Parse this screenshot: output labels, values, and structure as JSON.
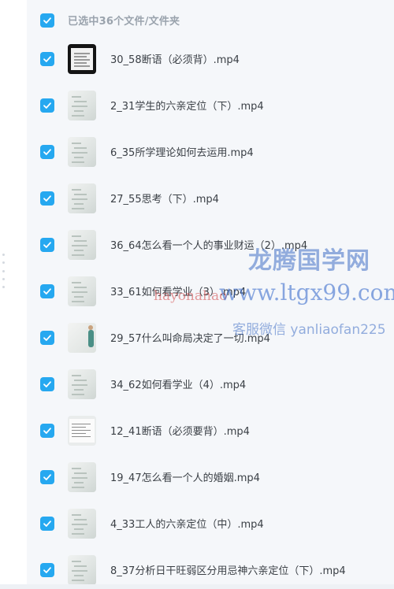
{
  "header": {
    "selection_text": "已选中36个文件/文件夹",
    "select_all_checked": true
  },
  "colors": {
    "accent": "#26a8f0",
    "text": "#3a3f45",
    "muted": "#9aa3ad"
  },
  "files": [
    {
      "name": "30_58断语（必须背）.mp4",
      "thumb": "dark"
    },
    {
      "name": "2_31学生的六亲定位（下）.mp4",
      "thumb": "board"
    },
    {
      "name": "6_35所学理论如何去运用.mp4",
      "thumb": "board"
    },
    {
      "name": "27_55思考（下）.mp4",
      "thumb": "board"
    },
    {
      "name": "36_64怎么看一个人的事业财运（2）.mp4",
      "thumb": "board"
    },
    {
      "name": "33_61如何看学业（3）.mp4",
      "thumb": "board"
    },
    {
      "name": "29_57什么叫命局决定了一切.mp4",
      "thumb": "person"
    },
    {
      "name": "34_62如何看学业（4）.mp4",
      "thumb": "board"
    },
    {
      "name": "12_41断语（必须要背）.mp4",
      "thumb": "light"
    },
    {
      "name": "19_47怎么看一个人的婚姻.mp4",
      "thumb": "board"
    },
    {
      "name": "4_33工人的六亲定位（中）.mp4",
      "thumb": "board"
    },
    {
      "name": "8_37分析日干旺弱区分用忌神六亲定位（下）.mp4",
      "thumb": "board"
    }
  ],
  "watermarks": {
    "line1": "龙腾国学网",
    "line2": "www.ltgx99.com",
    "line3": "hayonahao",
    "line4": "客服微信 yanliaofan225"
  }
}
